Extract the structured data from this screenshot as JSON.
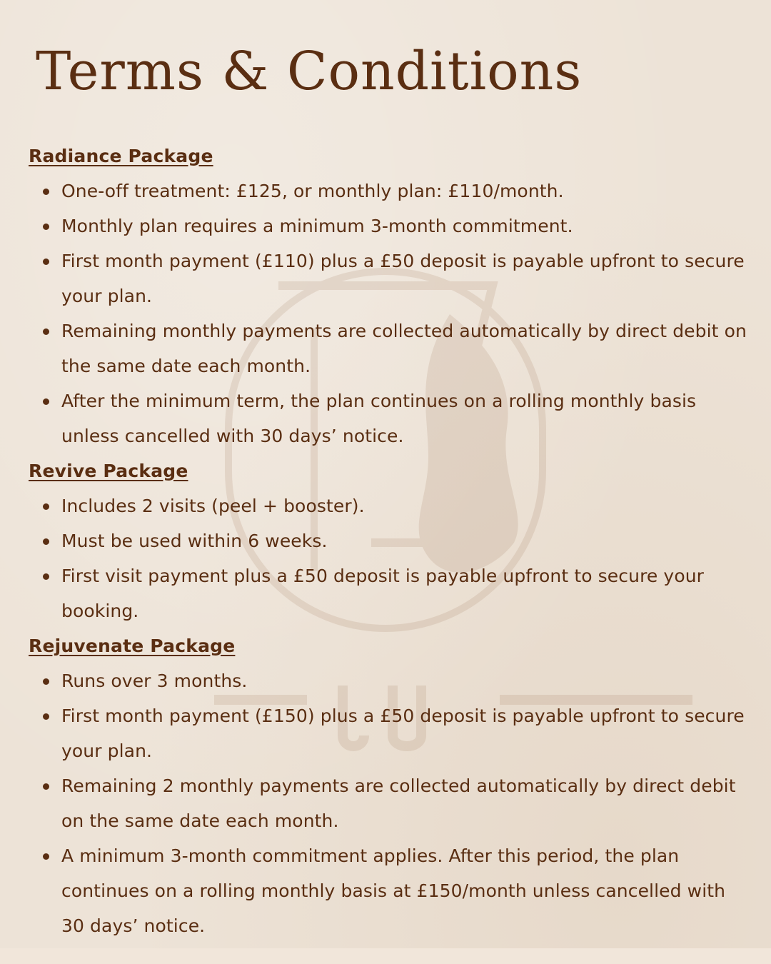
{
  "title": "Terms & Conditions",
  "sections": [
    {
      "heading": "Radiance Package",
      "items": [
        "One-off treatment: £125, or monthly plan: £110/month.",
        "Monthly plan requires a minimum 3-month commitment.",
        "First month payment (£110) plus a £50 deposit is payable upfront to secure your plan.",
        "Remaining monthly payments are collected automatically by direct debit on the same date each month.",
        "After the minimum term, the plan continues on a rolling monthly basis unless cancelled with 30 days’ notice."
      ]
    },
    {
      "heading": "Revive Package",
      "items": [
        "Includes 2 visits (peel + booster).",
        "Must be used within 6 weeks.",
        "First visit payment plus a £50 deposit is payable upfront to secure your booking."
      ]
    },
    {
      "heading": "Rejuvenate Package",
      "items": [
        "Runs over 3 months.",
        "First month payment (£150) plus a £50 deposit is payable upfront to secure your plan.",
        "Remaining 2 monthly payments are collected automatically by direct debit on the same date each month.",
        "A minimum 3-month commitment applies. After this period, the plan continues on a rolling monthly basis at £150/month unless cancelled with 30 days’ notice."
      ]
    }
  ],
  "colors": {
    "background": "#ede3d7",
    "text": "#5a2e12",
    "watermark": "#b08a6a"
  },
  "icons": {
    "watermark": "logo-watermark-icon"
  }
}
